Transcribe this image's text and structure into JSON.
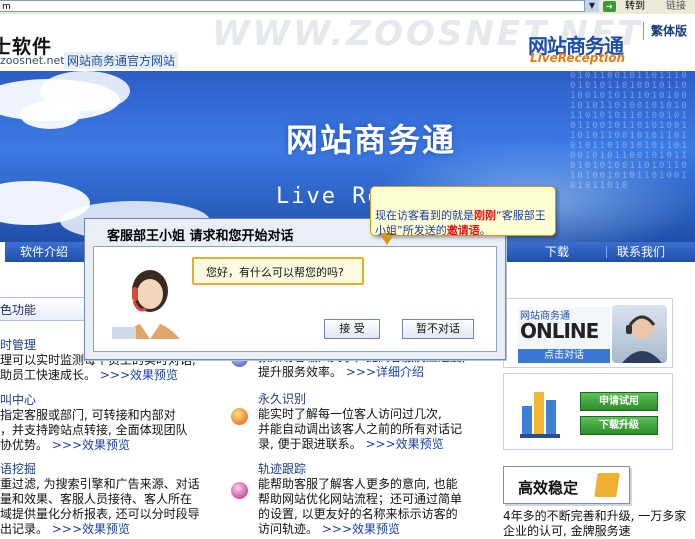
{
  "browser": {
    "address_text": "m",
    "go_label": "转到",
    "links_label": "链接"
  },
  "header": {
    "logo_title": "士软件",
    "logo_domain": "zoosnet.net",
    "logo_subtitle": "网站商务通官方网站",
    "watermark": "WWW.ZOOSNET.NET",
    "brand_cn": "网站商务通",
    "brand_en": "LiveReception",
    "lang_link": "繁体版"
  },
  "banner": {
    "title": "网站商务通",
    "subtitle_en": "Live Rec",
    "binary": "0101100101101110010101101001011010010101110101001010110100101010110101011010010101100101101010011010110010101101010110101010110100101011001010110101010011010110101001010110100101011010"
  },
  "nav": {
    "items": [
      {
        "id": "intro",
        "label": "软件介绍"
      },
      {
        "id": "download",
        "label": "下载"
      },
      {
        "id": "contact",
        "label": "联系我们"
      }
    ]
  },
  "left": {
    "section_heading": "色功能",
    "blocks": [
      {
        "title": "时管理",
        "lines": [
          "理可以实时监测每个员工的实时对话,",
          "助员工快速成长。"
        ],
        "more": ">>>效果预览"
      },
      {
        "title": "叫中心",
        "lines": [
          "指定客服或部门, 可转接和内部对",
          "，并支持跨站点转接, 全面体现团队"
        ],
        "last_line": "协优势。",
        "more": ">>>效果预览"
      },
      {
        "title": "语挖掘",
        "lines": [
          "重过滤, 为搜索引擎和广告来源、对话",
          "量和效果、客服人员接待、客人所在",
          "域提供量化分析报表, 还可以分时段导",
          "出记录。"
        ],
        "more": ">>>效果预览"
      }
    ]
  },
  "middle": {
    "rows": [
      {
        "title": "",
        "lines": [
          "预知访客输入文字，提高客服反应速度,"
        ],
        "last_line": "提升服务效率。",
        "more": ">>>详细介绍",
        "icon": "eye-icon"
      },
      {
        "title": "永久识别",
        "lines": [
          "能实时了解每一位客人访问过几次,",
          "并能自动调出该客人之前的所有对话记"
        ],
        "last_line": "录, 便于跟进联系。",
        "more": ">>>效果预览",
        "icon": "id-icon"
      },
      {
        "title": "轨迹跟踪",
        "lines": [
          "能帮助客服了解客人更多的意向, 也能",
          "帮助网站优化网站流程；还可通过简单",
          "的设置, 以更友好的名称来标示访客的"
        ],
        "last_line": "访问轨迹。",
        "more": ">>>效果预览",
        "icon": "track-icon"
      }
    ]
  },
  "right": {
    "online_logo_cn": "网站商务通",
    "online_logo_big": "ONLINE",
    "online_btn": "点击对话",
    "apply_btn": "申请试用",
    "upgrade_btn": "下载升级",
    "stable_label": "高效稳定",
    "stable_text": "4年多的不断完善和升级, 一万多家企业的认可, 金牌服务速"
  },
  "chat": {
    "title": "客服部王小姐  请求和您开始对话",
    "message": "您好，有什么可以帮您的吗?",
    "accept": "接  受",
    "decline": "暂不对话"
  },
  "tooltip": {
    "part1": "现在访客看到的就是",
    "em1": "刚刚",
    "part2": "“客服部王小姐”所发送的",
    "em2": "邀请语",
    "part3": "。"
  },
  "colors": {
    "nav_blue": "#1e4fa9",
    "link_blue": "#1a42a0",
    "tooltip_accent": "#e0141c",
    "brand_orange": "#e77b10"
  }
}
